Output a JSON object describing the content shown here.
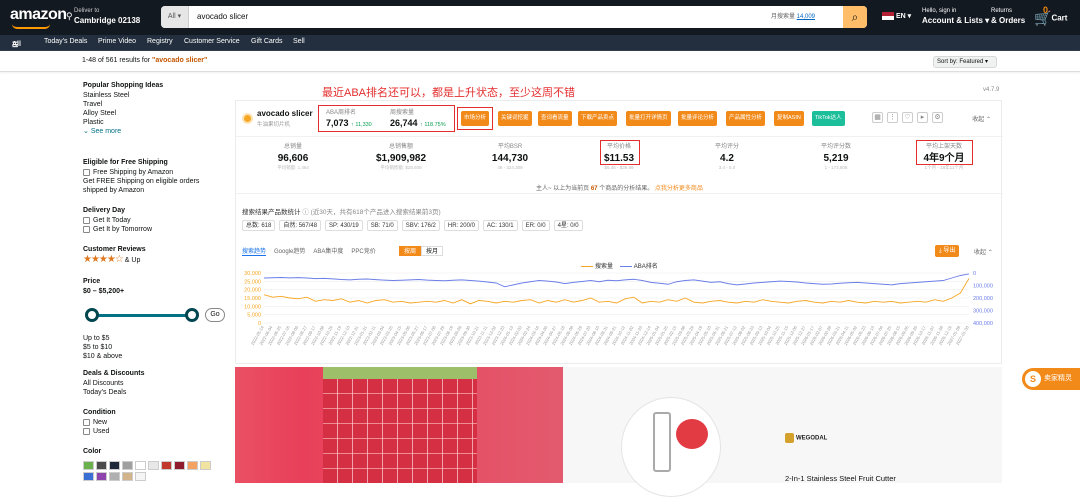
{
  "header": {
    "logo": "amazon",
    "deliver_line1": "Deliver to",
    "deliver_line2": "Cambridge 02138",
    "search_category": "All",
    "search_query": "avocado slicer",
    "search_volume_label": "月搜索量",
    "search_volume_value": "14,009",
    "language": "EN",
    "account_line1": "Hello, sign in",
    "account_line2": "Account & Lists",
    "returns_line1": "Returns",
    "returns_line2": "& Orders",
    "cart_count": "0",
    "cart_label": "Cart"
  },
  "subnav": [
    "All",
    "Today's Deals",
    "Prime Video",
    "Registry",
    "Customer Service",
    "Gift Cards",
    "Sell"
  ],
  "results": {
    "text": "1-48 of 561 results for ",
    "query": "\"avocado slicer\"",
    "sort": "Sort by: Featured"
  },
  "sidebar": {
    "popular_title": "Popular Shopping Ideas",
    "popular_items": [
      "Stainless Steel",
      "Travel",
      "Alloy Steel",
      "Plastic"
    ],
    "see_more": "See more",
    "free_ship_title": "Eligible for Free Shipping",
    "free_ship_opt": "Free Shipping by Amazon",
    "free_ship_desc": "Get FREE Shipping on eligible orders shipped by Amazon",
    "delivery_title": "Delivery Day",
    "delivery_opts": [
      "Get It Today",
      "Get It by Tomorrow"
    ],
    "reviews_title": "Customer Reviews",
    "reviews_up": "& Up",
    "price_title": "Price",
    "price_range": "$0 – $5,200+",
    "go": "Go",
    "price_links": [
      "Up to $5",
      "$5 to $10",
      "$10 & above"
    ],
    "deals_title": "Deals & Discounts",
    "deals_items": [
      "All Discounts",
      "Today's Deals"
    ],
    "condition_title": "Condition",
    "condition_opts": [
      "New",
      "Used"
    ],
    "color_title": "Color",
    "colors": [
      "#6ab04c",
      "#4b4b4b",
      "#1e2a3a",
      "#a0a0a0",
      "#ffffff",
      "#e8e8e8",
      "#c0392b",
      "#8e1c2c",
      "#f4a261",
      "#f1e3a0",
      "#3b6fd4",
      "#8e44ad",
      "#b0b0b0",
      "#d2b48c",
      "#f5f5f5"
    ]
  },
  "ext": {
    "version": "v4.7.9",
    "annotation": "最近ABA排名还可以，都是上升状态，至少这周不错",
    "keyword": "avocado slicer",
    "keyword_sub": "牛油果切片机",
    "aba_rank_label": "ABA周排名",
    "aba_rank_value": "7,073",
    "aba_rank_delta": "↑ 11,330",
    "search_vol_label": "周搜索量",
    "search_vol_value": "26,744",
    "search_vol_delta": "↑ 118.75%",
    "buttons": [
      "市场分析",
      "关键词挖掘",
      "查词看流量",
      "下载产品卖点",
      "批量打开详情页",
      "批量评论分析",
      "产品属性分析",
      "复制ASIN",
      "TikTok达人"
    ],
    "collapse": "收起",
    "stats": [
      {
        "label": "总销量",
        "value": "96,606",
        "sub": "平均销量: 1,464"
      },
      {
        "label": "总销售额",
        "value": "$1,909,982",
        "sub": "平均销售额: $28,939"
      },
      {
        "label": "平均BSR",
        "value": "144,730",
        "sub": "46 - 324,309"
      },
      {
        "label": "平均价格",
        "value": "$11.53",
        "sub": "$5.46 - $39.99"
      },
      {
        "label": "平均评分",
        "value": "4.2",
        "sub": "3.4 - 5.0"
      },
      {
        "label": "平均评分数",
        "value": "5,219",
        "sub": "1 - 173,806"
      },
      {
        "label": "平均上架天数",
        "value": "4年9个月",
        "sub": "1个月 - 18年11个月"
      }
    ],
    "note_pre": "主人~ 以上为当前页 ",
    "note_num": "67",
    "note_post": " 个商品的分析结果。",
    "note_link": "点我分析更多商品",
    "stat_title": "搜索结果产品数统计",
    "stat_sub": "(近30天，共有618个产品进入搜索结果前3页)",
    "tags": [
      "总数: 618",
      "自然: 567/48",
      "SP: 430/19",
      "SB: 71/0",
      "SBV: 176/2",
      "HR: 200/0",
      "AC: 130/1",
      "ER: 0/0",
      "4星: 0/0"
    ],
    "chart_tabs": [
      "搜索趋势",
      "Google趋势",
      "ABA集中度",
      "PPC竞价"
    ],
    "period": [
      "按周",
      "按月"
    ],
    "export": "导出",
    "collapse2": "收起"
  },
  "chart_data": {
    "type": "line",
    "series": [
      {
        "name": "搜索量",
        "color": "#f5a623",
        "values": [
          17000,
          15500,
          16000,
          15000,
          14500,
          15500,
          13000,
          14000,
          13500,
          14500,
          12500,
          13500,
          12000,
          13500,
          14000,
          12500,
          13000,
          12000,
          12500,
          13000,
          12500,
          13500,
          12000,
          14000,
          11500,
          13500,
          13000,
          12000,
          13000,
          12500,
          13500,
          14000,
          12000,
          13500,
          12500,
          14000,
          12500,
          13500,
          15000,
          12500,
          13000,
          12000,
          14500,
          15500,
          12000,
          13000,
          12500,
          14000,
          13000,
          15000,
          12500,
          12000,
          13000,
          13500,
          12500,
          12000,
          13000,
          12500,
          14000,
          13000,
          12500,
          12000,
          13000,
          13500,
          12500,
          12000,
          13000,
          12500,
          13500,
          12500,
          12000,
          13000,
          12500,
          13000,
          12000,
          12500,
          13000,
          12500,
          14000,
          13000,
          15000,
          18000,
          26744
        ]
      },
      {
        "name": "ABA排名",
        "color": "#6c7ee8",
        "values": [
          40000,
          38000,
          36000,
          39000,
          37000,
          40000,
          45000,
          43000,
          47000,
          52000,
          55000,
          50000,
          48000,
          53000,
          57000,
          60000,
          58000,
          55000,
          52000,
          57000,
          60000,
          62000,
          58000,
          55000,
          60000,
          65000,
          72000,
          80000,
          110000,
          95000,
          80000,
          70000,
          60000,
          65000,
          72000,
          85000,
          75000,
          68000,
          60000,
          70000,
          58000,
          62000,
          55000,
          50000,
          60000,
          75000,
          82000,
          90000,
          70000,
          60000,
          55000,
          65000,
          75000,
          70000,
          85000,
          95000,
          88000,
          80000,
          75000,
          70000,
          65000,
          68000,
          72000,
          80000,
          85000,
          90000,
          88000,
          82000,
          78000,
          75000,
          80000,
          85000,
          90000,
          95000,
          85000,
          80000,
          75000,
          70000,
          65000,
          60000,
          40000,
          20000,
          7073
        ]
      }
    ],
    "y_left": {
      "min": 0,
      "max": 30000,
      "ticks": [
        "30,000",
        "25,000",
        "20,000",
        "15,000",
        "10,000",
        "5,000",
        "0"
      ]
    },
    "y_right": {
      "min": 0,
      "max": 400000,
      "ticks": [
        "0",
        "100,000",
        "200,000",
        "300,000",
        "400,000"
      ],
      "reversed": true
    },
    "x_labels": [
      "2022-05-14",
      "2022-06-04",
      "2022-06-25",
      "2022-07-16",
      "2022-08-06",
      "2022-08-27",
      "2022-09-17",
      "2022-10-08",
      "2022-10-29",
      "2022-11-19",
      "2022-12-10",
      "2022-12-31",
      "2023-01-21",
      "2023-02-11",
      "2023-03-04",
      "2023-03-25",
      "2023-04-15",
      "2023-05-06",
      "2023-05-27",
      "2023-06-17",
      "2023-07-08",
      "2023-07-29",
      "2023-08-19",
      "2023-09-09",
      "2023-09-30",
      "2023-10-21",
      "2023-11-11",
      "2023-12-02",
      "2023-12-23",
      "2024-01-13",
      "2024-02-03",
      "2024-02-24",
      "2024-03-16",
      "2024-04-06",
      "2024-04-27",
      "2024-05-18",
      "2024-06-08",
      "2024-06-29",
      "2024-07-20",
      "2024-08-10",
      "2024-08-31",
      "2024-09-21",
      "2024-10-12",
      "2024-11-02",
      "2024-11-23",
      "2024-12-14",
      "2025-01-04",
      "2025-01-25",
      "2025-02-15",
      "2025-03-08",
      "2025-03-29",
      "2025-04-19",
      "2025-05-10",
      "2025-05-31",
      "2025-06-21",
      "2025-07-12",
      "2025-08-02",
      "2025-08-23",
      "2025-09-13",
      "2025-10-04",
      "2025-10-25",
      "2025-11-15",
      "2025-12-06",
      "2025-12-27",
      "2026-01-17",
      "2026-02-07",
      "2026-02-28",
      "2026-03-21",
      "2026-04-11",
      "2026-05-02",
      "2026-05-23",
      "2026-06-13",
      "2026-07-04",
      "2026-07-25",
      "2026-08-15",
      "2026-09-05",
      "2026-09-26",
      "2026-10-17",
      "2026-11-07",
      "2026-11-28",
      "2026-12-19",
      "2027-01-09",
      "2027-01-30"
    ],
    "grid": true,
    "legend": "top-center"
  },
  "product": {
    "brand": "WEGODAL",
    "title": "2-In-1 Stainless Steel Fruit Cutter"
  },
  "floating": {
    "label": "卖家精灵",
    "icon": "S"
  }
}
